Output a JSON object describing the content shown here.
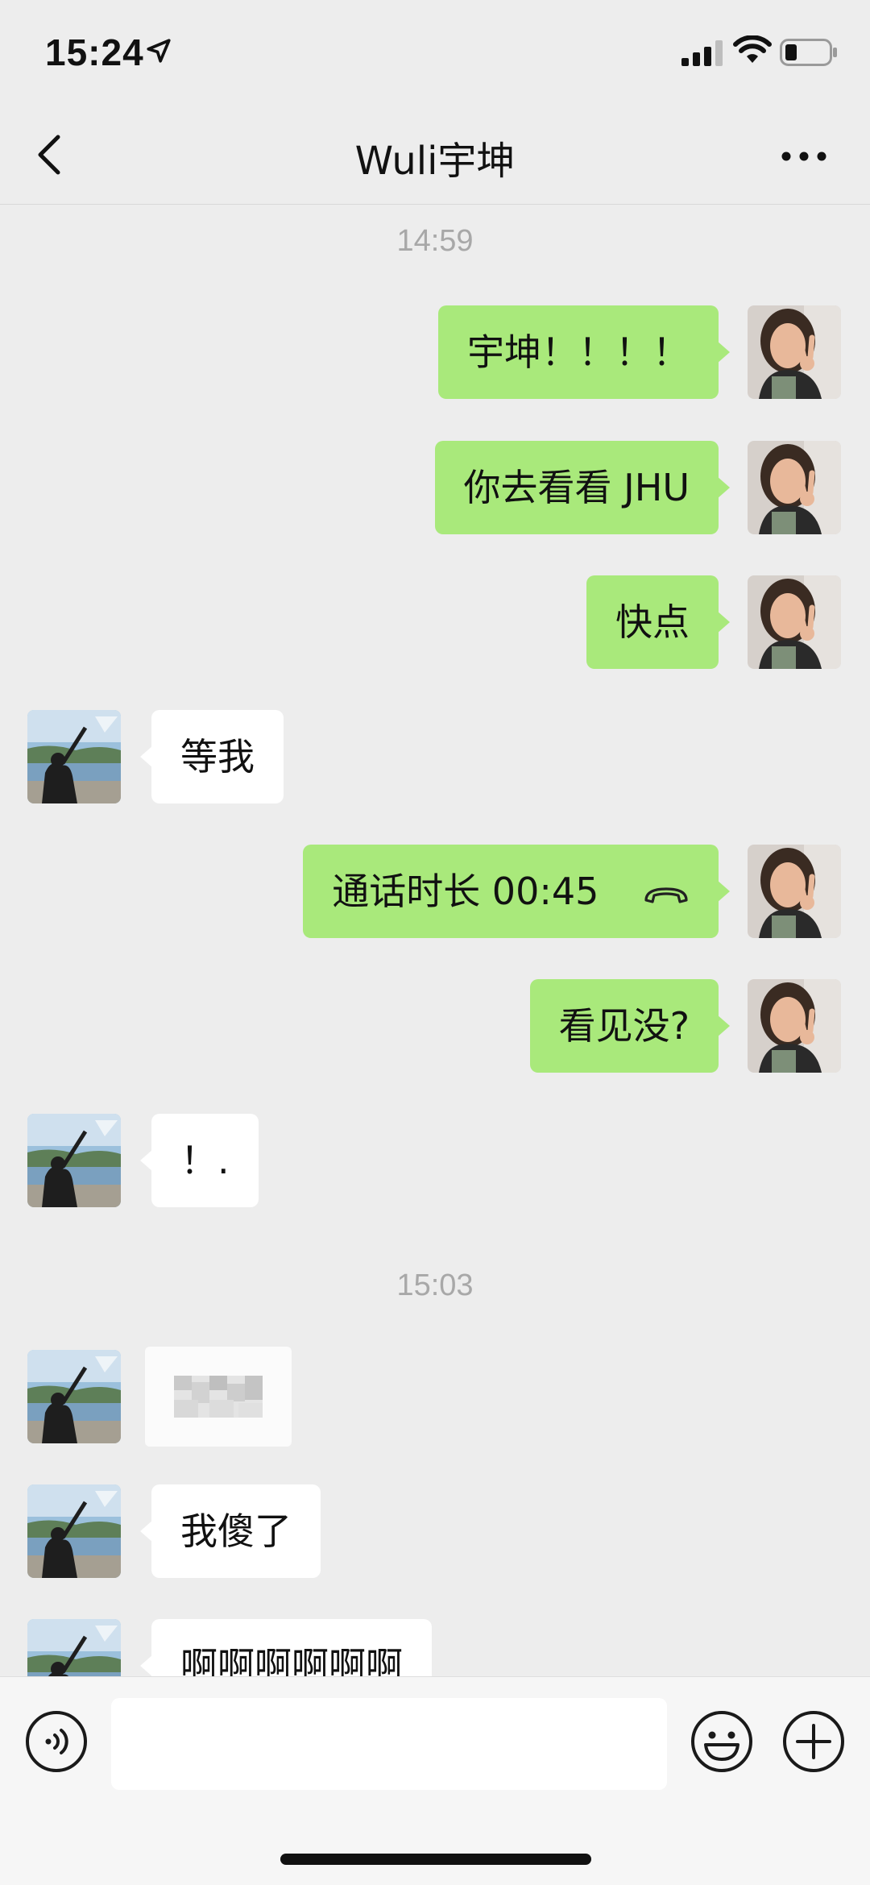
{
  "status_bar": {
    "time": "15:24",
    "location_icon": "location-arrow-icon",
    "signal_icon": "cellular-signal-icon",
    "wifi_icon": "wifi-icon",
    "battery_icon": "battery-low-icon"
  },
  "nav": {
    "title": "Wuli宇坤",
    "back_icon": "chevron-left-icon",
    "more_icon": "more-dots-icon"
  },
  "messages": {
    "timestamps": [
      "14:59",
      "15:03"
    ],
    "items": [
      {
        "sender": "self",
        "text": "宇坤！！！！"
      },
      {
        "sender": "self",
        "text": "你去看看 JHU"
      },
      {
        "sender": "self",
        "text": "快点"
      },
      {
        "sender": "other",
        "text": "等我"
      },
      {
        "sender": "self",
        "text": "通话时长 00:45",
        "icon": "phone-hangup-icon"
      },
      {
        "sender": "self",
        "text": "看见没?"
      },
      {
        "sender": "other",
        "text": "！."
      },
      {
        "sender": "other",
        "type": "image",
        "text": ""
      },
      {
        "sender": "other",
        "text": "我傻了"
      },
      {
        "sender": "other",
        "text": "啊啊啊啊啊啊"
      }
    ]
  },
  "input_bar": {
    "voice_icon": "voice-input-icon",
    "placeholder": "",
    "emoji_icon": "emoji-icon",
    "plus_icon": "plus-icon"
  },
  "colors": {
    "background": "#ededed",
    "self_bubble": "#a9e97b",
    "other_bubble": "#ffffff",
    "timestamp": "#a8a8a8"
  }
}
